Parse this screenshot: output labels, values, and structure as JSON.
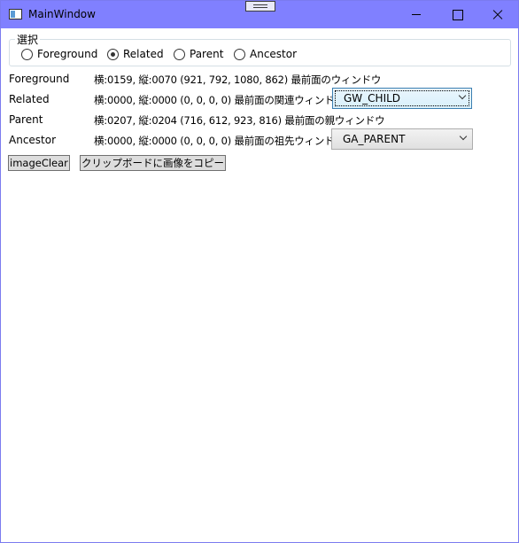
{
  "window": {
    "title": "MainWindow",
    "accent_color": "#8080ff"
  },
  "selection": {
    "legend": "選択",
    "options": [
      {
        "label": "Foreground",
        "checked": false
      },
      {
        "label": "Related",
        "checked": true
      },
      {
        "label": "Parent",
        "checked": false
      },
      {
        "label": "Ancestor",
        "checked": false
      }
    ]
  },
  "rows": [
    {
      "label": "Foreground",
      "value": "横:0159, 縦:0070  (921, 792, 1080, 862) 最前面のウィンドウ"
    },
    {
      "label": "Related",
      "value": "横:0000, 縦:0000  (0, 0, 0, 0) 最前面の関連ウィンドウ",
      "combo": "GW_CHILD"
    },
    {
      "label": "Parent",
      "value": "横:0207, 縦:0204  (716, 612, 923, 816) 最前面の親ウィンドウ"
    },
    {
      "label": "Ancestor",
      "value": "横:0000, 縦:0000  (0, 0, 0, 0) 最前面の祖先ウィンドウ",
      "combo": "GA_PARENT"
    }
  ],
  "buttons": {
    "image_clear": "imageClear",
    "copy_clipboard": "クリップボードに画像をコピー"
  }
}
